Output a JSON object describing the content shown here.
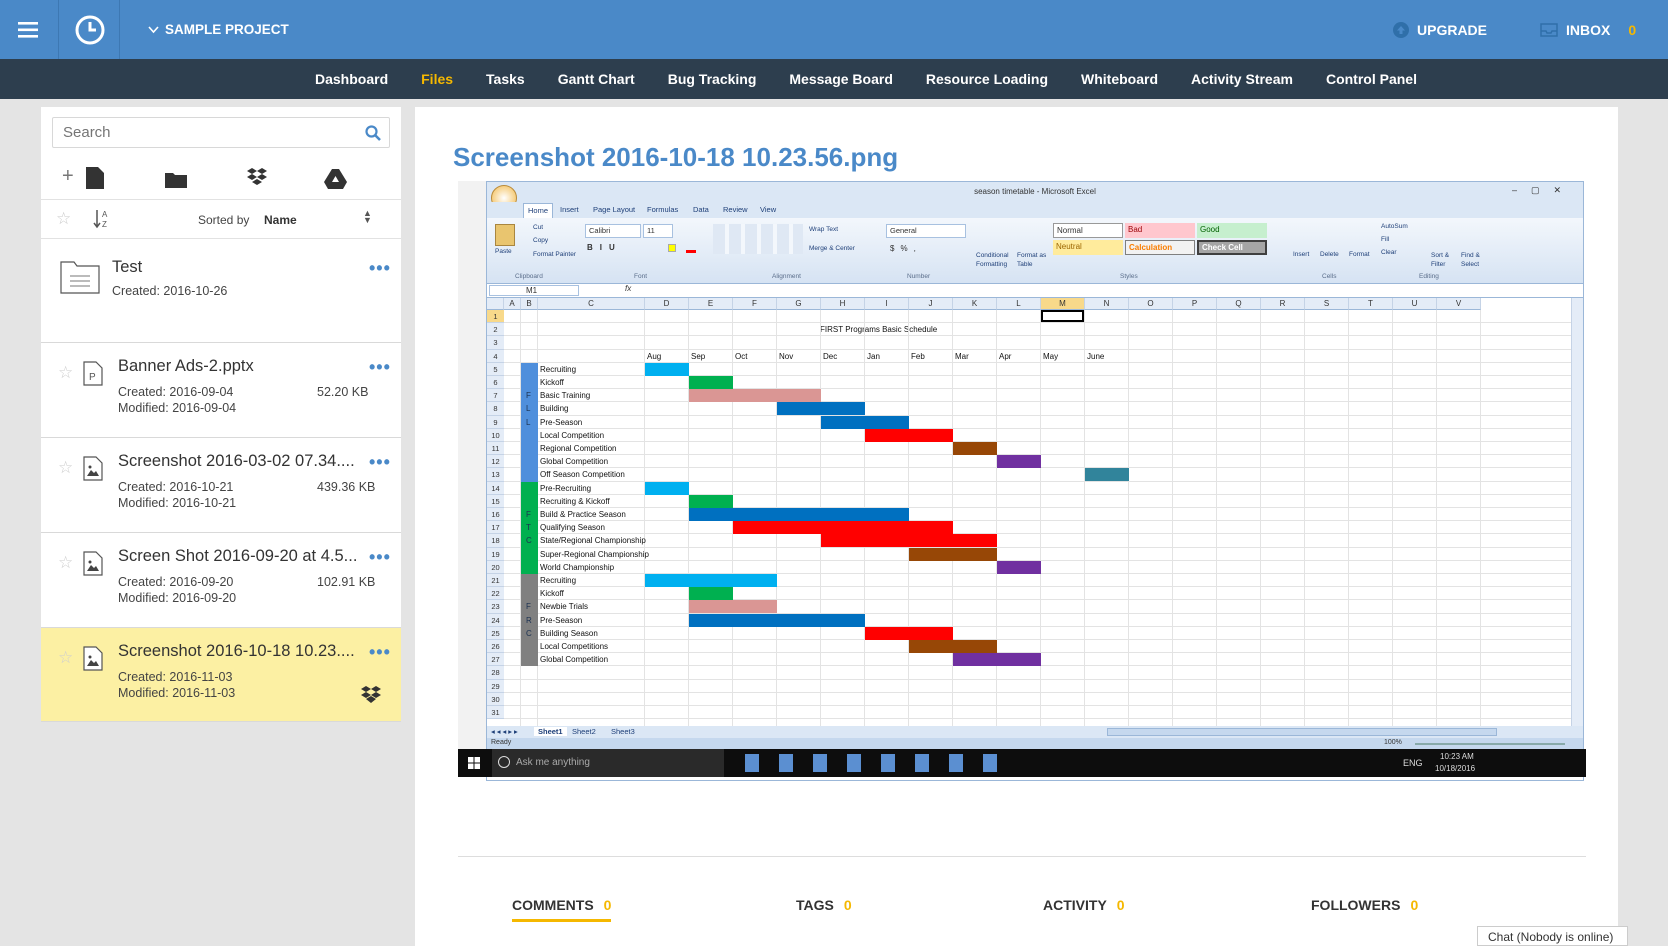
{
  "topbar": {
    "project": "SAMPLE PROJECT",
    "upgrade": "UPGRADE",
    "inbox": "INBOX",
    "inbox_count": "0"
  },
  "nav": {
    "items": [
      "Dashboard",
      "Files",
      "Tasks",
      "Gantt Chart",
      "Bug Tracking",
      "Message Board",
      "Resource Loading",
      "Whiteboard",
      "Activity Stream",
      "Control Panel"
    ],
    "active": "Files"
  },
  "sidebar": {
    "search_placeholder": "Search",
    "sorted_by": "Sorted by",
    "sort_value": "Name",
    "files": [
      {
        "name": "Test",
        "created": "Created: 2016-10-26",
        "modified": "",
        "size": ""
      },
      {
        "name": "Banner Ads-2.pptx",
        "created": "Created: 2016-09-04",
        "modified": "Modified: 2016-09-04",
        "size": "52.20 KB"
      },
      {
        "name": "Screenshot 2016-03-02 07.34....",
        "created": "Created: 2016-10-21",
        "modified": "Modified: 2016-10-21",
        "size": "439.36 KB"
      },
      {
        "name": "Screen Shot 2016-09-20 at 4.5...",
        "created": "Created: 2016-09-20",
        "modified": "Modified: 2016-09-20",
        "size": "102.91 KB"
      },
      {
        "name": "Screenshot 2016-10-18 10.23....",
        "created": "Created: 2016-11-03",
        "modified": "Modified: 2016-11-03",
        "size": ""
      }
    ]
  },
  "main": {
    "title": "Screenshot 2016-10-18 10.23.56.png",
    "tabs": [
      {
        "label": "COMMENTS",
        "count": "0"
      },
      {
        "label": "TAGS",
        "count": "0"
      },
      {
        "label": "ACTIVITY",
        "count": "0"
      },
      {
        "label": "FOLLOWERS",
        "count": "0"
      }
    ]
  },
  "chat": "Chat (Nobody is online)",
  "excel": {
    "window_title": "season timetable - Microsoft Excel",
    "ribbon_tabs": [
      "Home",
      "Insert",
      "Page Layout",
      "Formulas",
      "Data",
      "Review",
      "View"
    ],
    "clipboard": {
      "paste": "Paste",
      "cut": "Cut",
      "copy": "Copy",
      "format_painter": "Format Painter",
      "group": "Clipboard"
    },
    "font": {
      "name": "Calibri",
      "size": "11",
      "group": "Font"
    },
    "alignment": {
      "wrap": "Wrap Text",
      "merge": "Merge & Center",
      "group": "Alignment"
    },
    "number": {
      "format": "General",
      "group": "Number"
    },
    "styles": {
      "conditional": "Conditional Formatting",
      "format_table": "Format as Table",
      "normal": "Normal",
      "bad": "Bad",
      "good": "Good",
      "neutral": "Neutral",
      "calculation": "Calculation",
      "check": "Check Cell",
      "group": "Styles"
    },
    "cells": {
      "insert": "Insert",
      "delete": "Delete",
      "format": "Format",
      "group": "Cells"
    },
    "editing": {
      "autosum": "AutoSum",
      "fill": "Fill",
      "clear": "Clear",
      "sort": "Sort & Filter",
      "find": "Find & Select",
      "group": "Editing"
    },
    "name_box": "M1",
    "columns": [
      "A",
      "B",
      "C",
      "D",
      "E",
      "F",
      "G",
      "H",
      "I",
      "J",
      "K",
      "L",
      "M",
      "N",
      "O",
      "P",
      "Q",
      "R",
      "S",
      "T",
      "U",
      "V"
    ],
    "sheet_title": "FIRST Programs Basic Schedule",
    "months": [
      "Aug",
      "Sep",
      "Oct",
      "Nov",
      "Dec",
      "Jan",
      "Feb",
      "Mar",
      "Apr",
      "May",
      "June"
    ],
    "rows": [
      {
        "row": 5,
        "label": "Recruiting",
        "start": 0,
        "len": 1,
        "color": "#00b0f0"
      },
      {
        "row": 6,
        "label": "Kickoff",
        "start": 1,
        "len": 1,
        "color": "#00b050"
      },
      {
        "row": 7,
        "label": "Basic Training",
        "start": 1,
        "len": 3,
        "color": "#da9694",
        "side": "F"
      },
      {
        "row": 8,
        "label": "Building",
        "start": 3,
        "len": 2,
        "color": "#0070c0",
        "side": "L"
      },
      {
        "row": 9,
        "label": "Pre-Season",
        "start": 4,
        "len": 2,
        "color": "#0070c0",
        "side": "L"
      },
      {
        "row": 10,
        "label": "Local Competition",
        "start": 5,
        "len": 2,
        "color": "#ff0000"
      },
      {
        "row": 11,
        "label": "Regional Competition",
        "start": 7,
        "len": 1,
        "color": "#974706"
      },
      {
        "row": 12,
        "label": "Global Competition",
        "start": 8,
        "len": 1,
        "color": "#7030a0"
      },
      {
        "row": 13,
        "label": "Off Season Competition",
        "start": 10,
        "len": 1,
        "color": "#31849b"
      },
      {
        "row": 14,
        "label": "Pre-Recruiting",
        "start": 0,
        "len": 1,
        "color": "#00b0f0"
      },
      {
        "row": 15,
        "label": "Recruiting & Kickoff",
        "start": 1,
        "len": 1,
        "color": "#00b050"
      },
      {
        "row": 16,
        "label": "Build & Practice Season",
        "start": 1,
        "len": 5,
        "color": "#0070c0",
        "side": "F"
      },
      {
        "row": 17,
        "label": "Qualifying Season",
        "start": 2,
        "len": 5,
        "color": "#ff0000",
        "side": "T"
      },
      {
        "row": 18,
        "label": "State/Regional Championship",
        "start": 4,
        "len": 4,
        "color": "#ff0000",
        "side": "C"
      },
      {
        "row": 19,
        "label": "Super-Regional Championship",
        "start": 6,
        "len": 2,
        "color": "#974706"
      },
      {
        "row": 20,
        "label": "World Championship",
        "start": 8,
        "len": 1,
        "color": "#7030a0"
      },
      {
        "row": 21,
        "label": "Recruiting",
        "start": 0,
        "len": 3,
        "color": "#00b0f0"
      },
      {
        "row": 22,
        "label": "Kickoff",
        "start": 1,
        "len": 1,
        "color": "#00b050"
      },
      {
        "row": 23,
        "label": "Newbie Trials",
        "start": 1,
        "len": 2,
        "color": "#da9694",
        "side": "F"
      },
      {
        "row": 24,
        "label": "Pre-Season",
        "start": 1,
        "len": 4,
        "color": "#0070c0",
        "side": "R"
      },
      {
        "row": 25,
        "label": "Building Season",
        "start": 5,
        "len": 2,
        "color": "#ff0000",
        "side": "C"
      },
      {
        "row": 26,
        "label": "Local Competitions",
        "start": 6,
        "len": 2,
        "color": "#974706"
      },
      {
        "row": 27,
        "label": "Global Competition",
        "start": 7,
        "len": 2,
        "color": "#7030a0"
      }
    ],
    "sheets": [
      "Sheet1",
      "Sheet2",
      "Sheet3"
    ],
    "status": "Ready",
    "zoom": "100%",
    "taskbar": {
      "search": "Ask me anything",
      "lang": "ENG",
      "time": "10:23 AM",
      "date": "10/18/2016"
    }
  }
}
